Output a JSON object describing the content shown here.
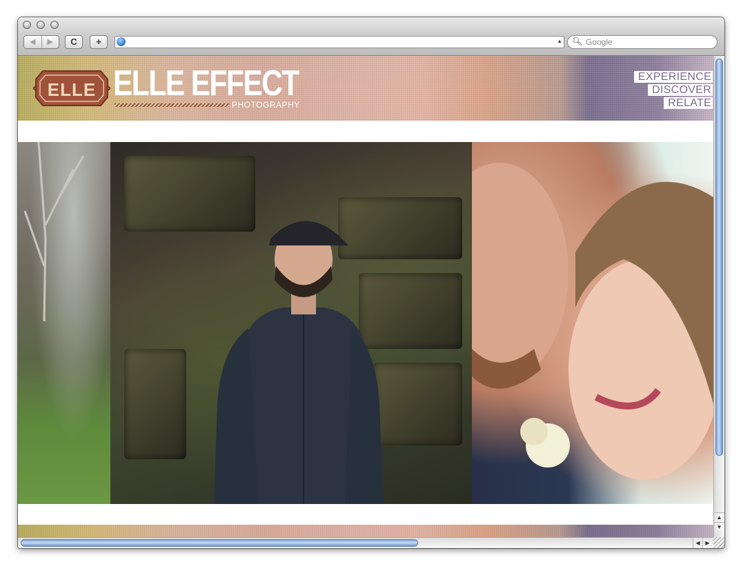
{
  "browser": {
    "back_label": "◀",
    "forward_label": "▶",
    "reload_label": "C",
    "add_label": "+",
    "address_value": "",
    "search_placeholder": "Google"
  },
  "site": {
    "brand_name": "ELLE EFFECT",
    "brand_sub": "PHOTOGRAPHY",
    "logo_text": "ELLE",
    "menu": [
      "EXPERIENCE",
      "DISCOVER",
      "RELATE"
    ],
    "accent_colors": {
      "menu_text": "#7c6d8f",
      "logo_brown": "#a0523a"
    }
  },
  "gallery": {
    "photos": [
      "forest-edge-photo",
      "man-by-stone-wall-photo",
      "couple-portrait-photo"
    ]
  },
  "scrollbars": {
    "vertical_up": "▲",
    "vertical_down": "▼",
    "horizontal_left": "◀",
    "horizontal_right": "▶"
  }
}
